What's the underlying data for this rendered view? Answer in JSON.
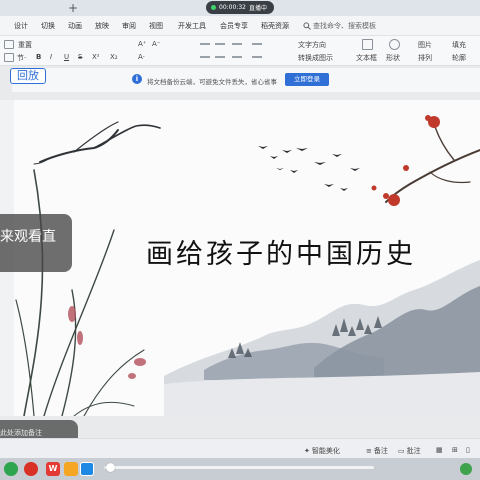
{
  "live": {
    "timer": "00:00:32",
    "status": "直播中"
  },
  "menu": {
    "tabs": [
      "设计",
      "切换",
      "动画",
      "放映",
      "审阅",
      "视图",
      "开发工具",
      "会员专享",
      "稻壳资源"
    ],
    "search_label": "查找命令、搜索模板"
  },
  "toolbar": {
    "font_name": "重置",
    "text_box_label": "文本框",
    "shape_label": "形状",
    "picture_label": "图片",
    "arrange_label": "排列",
    "fill_label": "填充",
    "outline_label": "轮廓",
    "text_direction_label": "文字方向",
    "convert_label": "转换成图示"
  },
  "notice": {
    "replay_label": "回放",
    "message": "将文档备份云端，可避免文件丢失，省心省事",
    "login_label": "立即登录"
  },
  "slide": {
    "title": "画给孩子的中国历史"
  },
  "overlays": {
    "caption": "来观看直",
    "note_placeholder": "此处添加备注"
  },
  "statusbar": {
    "smart_beautify": "智能美化",
    "notes_label": "备注",
    "annotate_label": "批注"
  },
  "colors": {
    "accent": "#2f6fd6",
    "plum_blossom": "#c0392b",
    "ink_mountains": "#5a6472"
  }
}
